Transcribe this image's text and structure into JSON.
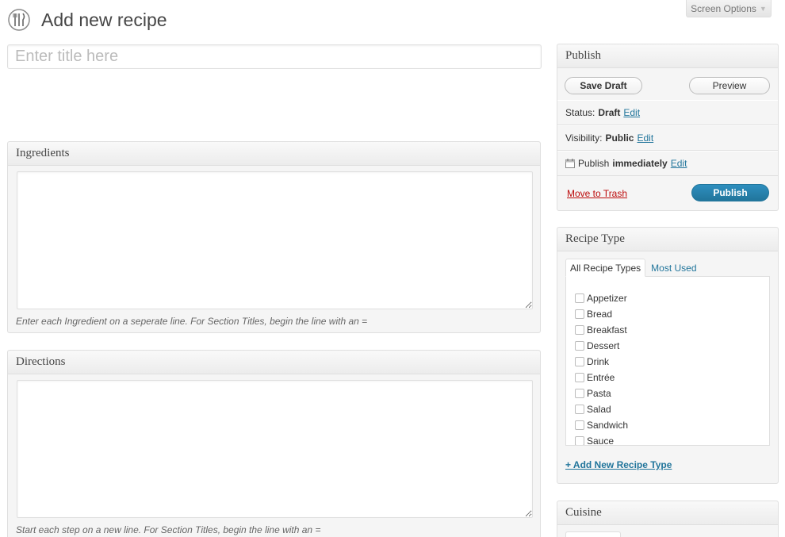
{
  "header": {
    "title": "Add new recipe",
    "icon": "recipe-utensils-icon",
    "screen_options": "Screen Options"
  },
  "title_field": {
    "placeholder": "Enter title here",
    "value": ""
  },
  "ingredients": {
    "heading": "Ingredients",
    "value": "",
    "hint": "Enter each Ingredient on a seperate line. For Section Titles, begin the line with an ="
  },
  "directions": {
    "heading": "Directions",
    "value": "",
    "hint": "Start each step on a new line. For Section Titles, begin the line with an ="
  },
  "publish": {
    "heading": "Publish",
    "save_draft": "Save Draft",
    "preview": "Preview",
    "status_label": "Status:",
    "status_value": "Draft",
    "visibility_label": "Visibility:",
    "visibility_value": "Public",
    "schedule_label": "Publish",
    "schedule_value": "immediately",
    "edit_label": "Edit",
    "trash": "Move to Trash",
    "publish_button": "Publish"
  },
  "recipe_type": {
    "heading": "Recipe Type",
    "tabs": [
      "All Recipe Types",
      "Most Used"
    ],
    "items": [
      "Appetizer",
      "Bread",
      "Breakfast",
      "Dessert",
      "Drink",
      "Entrée",
      "Pasta",
      "Salad",
      "Sandwich",
      "Sauce"
    ],
    "add_new": "+ Add New Recipe Type"
  },
  "cuisine": {
    "heading": "Cuisine"
  },
  "colors": {
    "link": "#21759b",
    "publish_button": "#21759b",
    "trash": "#bc0b0b"
  }
}
